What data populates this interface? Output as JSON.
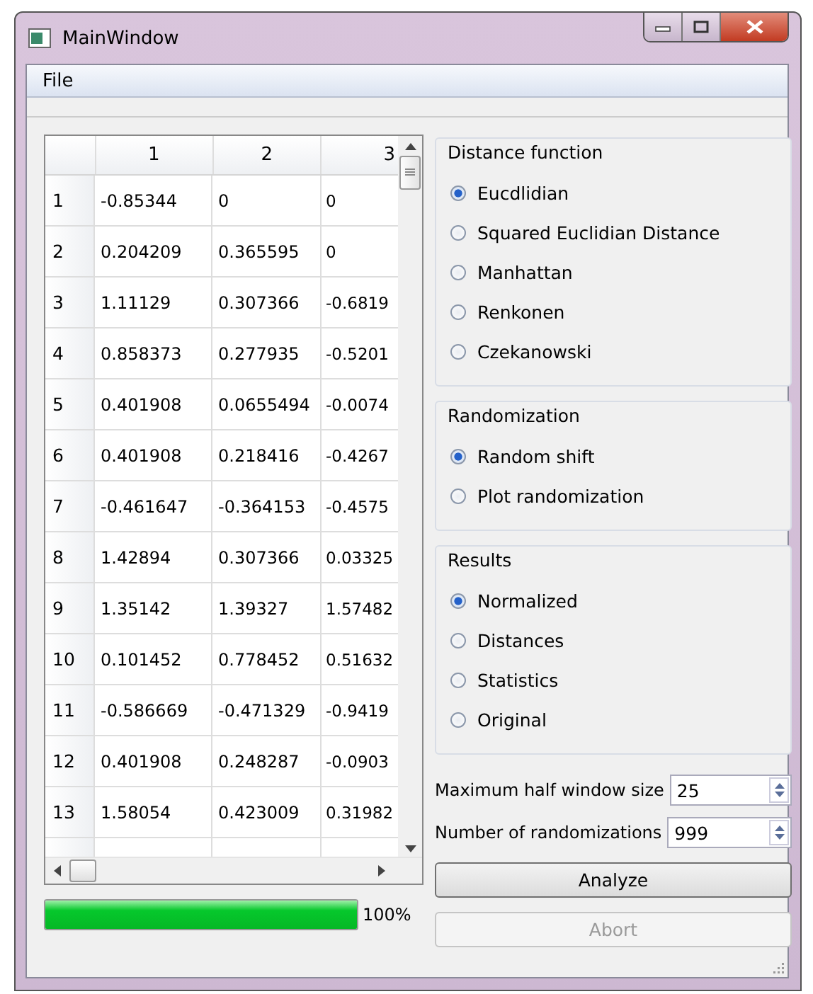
{
  "window": {
    "title": "MainWindow"
  },
  "menu": [
    "File"
  ],
  "table": {
    "columns": [
      "1",
      "2",
      "3"
    ],
    "rows": [
      {
        "header": "1",
        "cells": [
          "-0.85344",
          "0",
          "0"
        ]
      },
      {
        "header": "2",
        "cells": [
          "0.204209",
          "0.365595",
          "0"
        ]
      },
      {
        "header": "3",
        "cells": [
          "1.11129",
          "0.307366",
          "-0.6819"
        ]
      },
      {
        "header": "4",
        "cells": [
          "0.858373",
          "0.277935",
          "-0.5201"
        ]
      },
      {
        "header": "5",
        "cells": [
          "0.401908",
          "0.0655494",
          "-0.0074"
        ]
      },
      {
        "header": "6",
        "cells": [
          "0.401908",
          "0.218416",
          "-0.4267"
        ]
      },
      {
        "header": "7",
        "cells": [
          "-0.461647",
          "-0.364153",
          "-0.4575"
        ]
      },
      {
        "header": "8",
        "cells": [
          "1.42894",
          "0.307366",
          "0.03325"
        ]
      },
      {
        "header": "9",
        "cells": [
          "1.35142",
          "1.39327",
          "1.57482"
        ]
      },
      {
        "header": "10",
        "cells": [
          "0.101452",
          "0.778452",
          "0.51632"
        ]
      },
      {
        "header": "11",
        "cells": [
          "-0.586669",
          "-0.471329",
          "-0.9419"
        ]
      },
      {
        "header": "12",
        "cells": [
          "0.401908",
          "0.248287",
          "-0.0903"
        ]
      },
      {
        "header": "13",
        "cells": [
          "1.58054",
          "0.423009",
          "0.31982"
        ]
      }
    ]
  },
  "progress": {
    "level": 1,
    "reading": "100%"
  },
  "groups": [
    {
      "title": "Distance function",
      "options": [
        {
          "label": "Eucdlidian",
          "selected": true
        },
        {
          "label": "Squared Euclidian Distance",
          "selected": false
        },
        {
          "label": "Manhattan",
          "selected": false
        },
        {
          "label": "Renkonen",
          "selected": false
        },
        {
          "label": "Czekanowski",
          "selected": false
        }
      ]
    },
    {
      "title": "Randomization",
      "options": [
        {
          "label": "Random shift",
          "selected": true
        },
        {
          "label": "Plot randomization",
          "selected": false
        }
      ]
    },
    {
      "title": "Results",
      "options": [
        {
          "label": "Normalized",
          "selected": true
        },
        {
          "label": "Distances",
          "selected": false
        },
        {
          "label": "Statistics",
          "selected": false
        },
        {
          "label": "Original",
          "selected": false
        }
      ]
    }
  ],
  "spinboxes": [
    {
      "label": "Maximum half window size",
      "value": "25"
    },
    {
      "label": "Number of randomizations",
      "value": "999"
    }
  ],
  "buttons": [
    {
      "label": "Analyze",
      "disabled": false
    },
    {
      "label": "Abort",
      "disabled": true
    }
  ]
}
